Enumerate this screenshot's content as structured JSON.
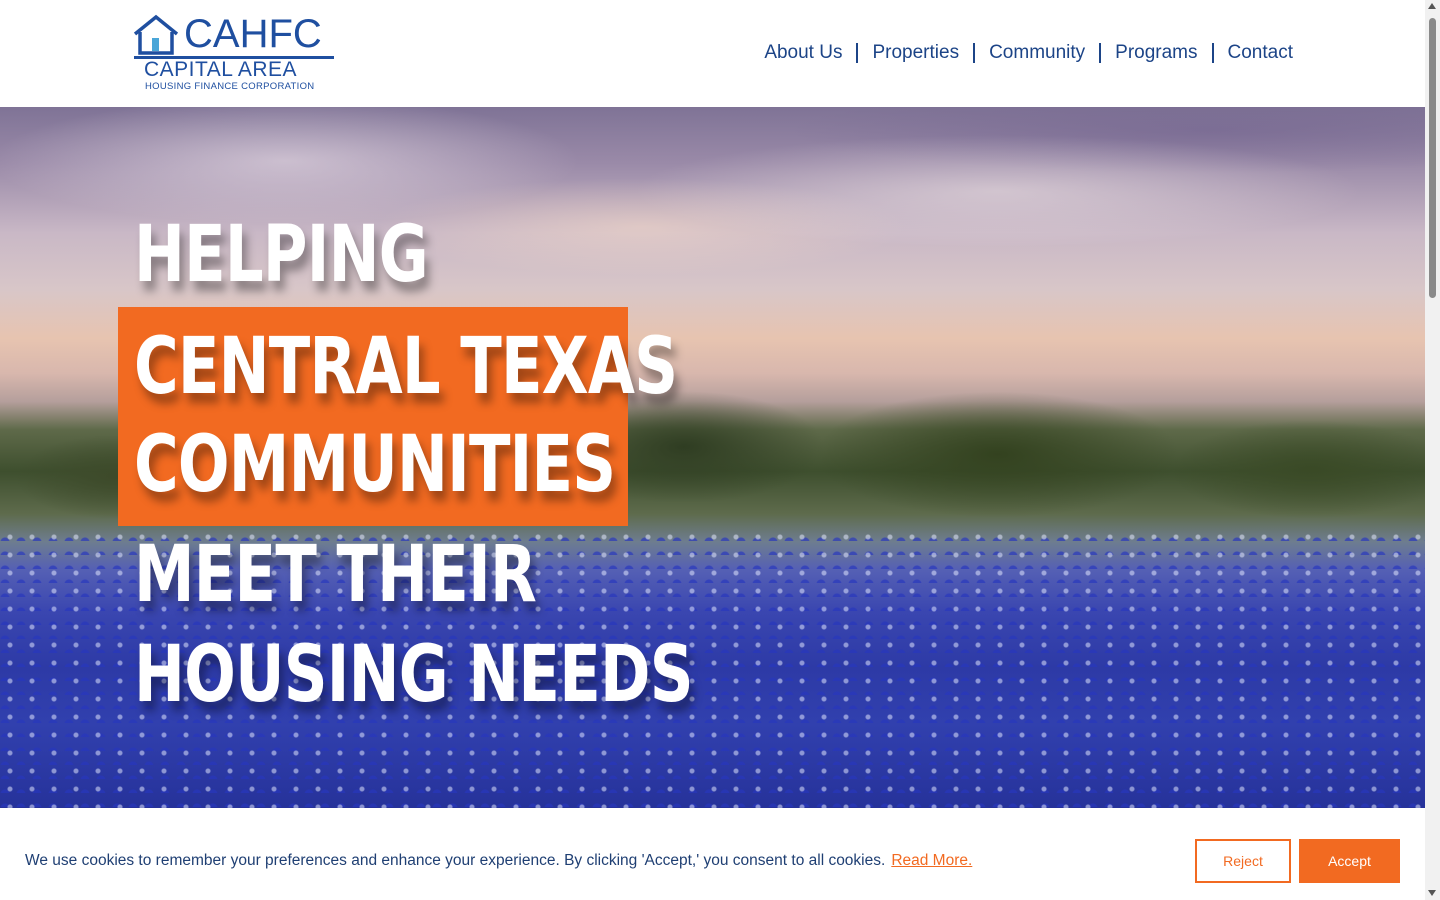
{
  "header": {
    "logo": {
      "acronym": "CAHFC",
      "name": "CAPITAL AREA",
      "subtitle": "HOUSING FINANCE CORPORATION"
    },
    "nav": [
      {
        "label": "About Us"
      },
      {
        "label": "Properties"
      },
      {
        "label": "Community"
      },
      {
        "label": "Programs"
      },
      {
        "label": "Contact"
      }
    ]
  },
  "hero": {
    "line1": "HELPING",
    "line2": "CENTRAL TEXAS",
    "line3": "COMMUNITIES",
    "line4": "MEET THEIR",
    "line5": "HOUSING NEEDS"
  },
  "cookie": {
    "text": "We use cookies to remember your preferences and enhance your experience. By clicking 'Accept,' you consent to all cookies.",
    "link": "Read More.",
    "reject": "Reject",
    "accept": "Accept"
  },
  "colors": {
    "brand_blue": "#1f4fa0",
    "accent_orange": "#f26a21"
  }
}
